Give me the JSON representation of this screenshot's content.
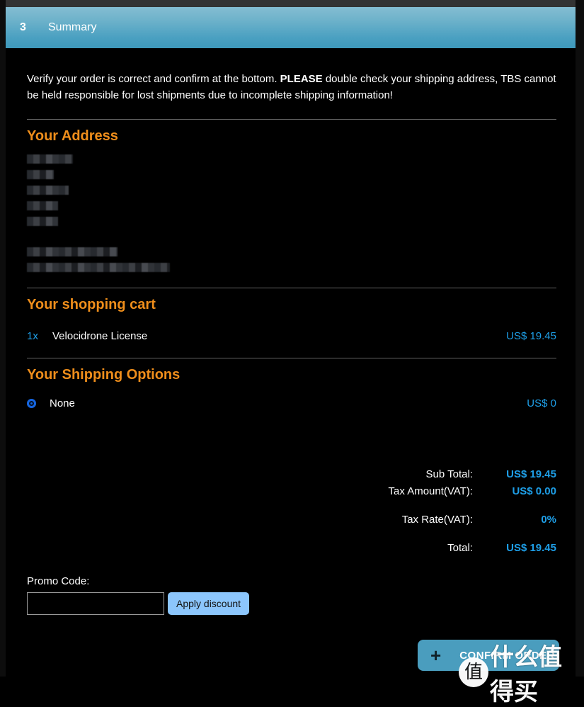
{
  "window": {
    "background_color": "#000000",
    "top_bar_color": "#333333"
  },
  "step_header": {
    "number": "3",
    "title": "Summary",
    "gradient_from": "#84bdd2",
    "gradient_to": "#3e99bc"
  },
  "intro": {
    "part1": "Verify your order is correct and confirm at the bottom. ",
    "emphasis": "PLEASE",
    "part2": " double check your shipping address, TBS cannot be held responsible for lost shipments due to incomplete shipping information!"
  },
  "sections": {
    "address_heading": "Your Address",
    "cart_heading": "Your shopping cart",
    "shipping_heading": "Your Shipping Options",
    "heading_color": "#ef8e1b"
  },
  "address": {
    "redacted": true,
    "lines": [
      "",
      "",
      "",
      "",
      "",
      "",
      ""
    ]
  },
  "cart": {
    "items": [
      {
        "qty": "1x",
        "name": "Velocidrone License",
        "price": "US$ 19.45"
      }
    ]
  },
  "shipping": {
    "options": [
      {
        "label": "None",
        "price": "US$ 0",
        "selected": true
      }
    ]
  },
  "totals": {
    "rows": [
      {
        "label": "Sub Total:",
        "value": "US$ 19.45"
      },
      {
        "label": "Tax Amount(VAT):",
        "value": "US$ 0.00"
      },
      {
        "label": "Tax Rate(VAT):",
        "value": "0%"
      },
      {
        "label": "Total:",
        "value": "US$ 19.45"
      }
    ],
    "value_color": "#1e9fe8"
  },
  "promo": {
    "label": "Promo Code:",
    "input_value": "",
    "placeholder": "",
    "button_label": "Apply discount",
    "button_color": "#8cc6fc"
  },
  "confirm": {
    "icon": "plus-icon",
    "label": "CONFIRM ORDER",
    "color": "#4a9dbe"
  },
  "watermark": {
    "badge": "值",
    "text": "什么值得买"
  }
}
